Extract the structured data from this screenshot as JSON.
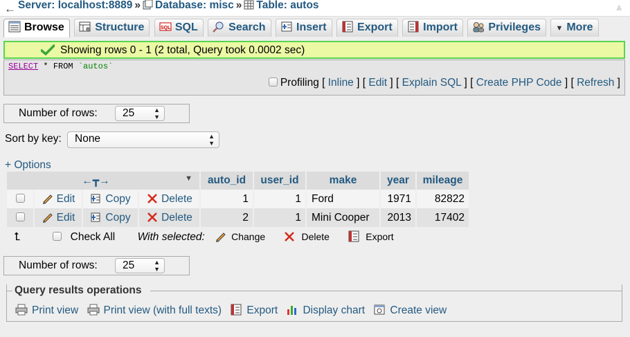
{
  "breadcrumb": {
    "server": "Server: localhost:8889",
    "database": "Database: misc",
    "table": "Table: autos",
    "separator": "»"
  },
  "tabs": [
    "Browse",
    "Structure",
    "SQL",
    "Search",
    "Insert",
    "Export",
    "Import",
    "Privileges",
    "More"
  ],
  "notice": "Showing rows 0 - 1 (2 total, Query took 0.0002 sec)",
  "sql": {
    "keyword_select": "SELECT",
    "rest": " * FROM ",
    "table": "`autos`"
  },
  "profiling": {
    "label": "Profiling",
    "links": [
      "Inline",
      "Edit",
      "Explain SQL",
      "Create PHP Code",
      "Refresh"
    ]
  },
  "rows_control": {
    "label": "Number of rows:",
    "value": "25"
  },
  "sort": {
    "label": "Sort by key:",
    "value": "None"
  },
  "options_link": "+ Options",
  "table": {
    "columns": [
      "auto_id",
      "user_id",
      "make",
      "year",
      "mileage"
    ],
    "actions": {
      "edit": "Edit",
      "copy": "Copy",
      "delete": "Delete"
    },
    "rows": [
      {
        "auto_id": "1",
        "user_id": "1",
        "make": "Ford",
        "year": "1971",
        "mileage": "82822"
      },
      {
        "auto_id": "2",
        "user_id": "1",
        "make": "Mini Cooper",
        "year": "2013",
        "mileage": "17402"
      }
    ]
  },
  "with_selected": {
    "check_all": "Check All",
    "label": "With selected:",
    "change": "Change",
    "delete": "Delete",
    "export": "Export"
  },
  "query_ops": {
    "legend": "Query results operations",
    "links": [
      "Print view",
      "Print view (with full texts)",
      "Export",
      "Display chart",
      "Create view"
    ]
  },
  "colors": {
    "link": "#235a81",
    "notice_bg": "#ebf8a4",
    "notice_border": "#57d54e"
  }
}
